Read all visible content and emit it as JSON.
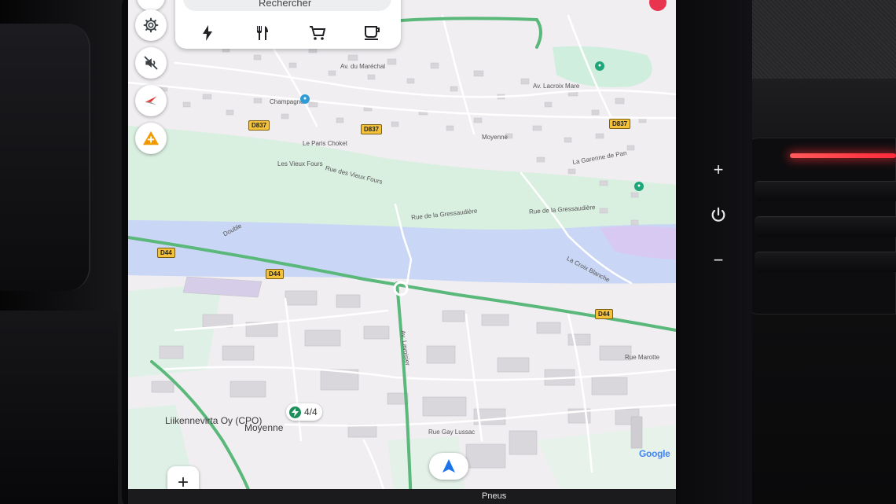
{
  "search": {
    "placeholder": "Rechercher"
  },
  "categories": [
    {
      "icon": "lightning-icon",
      "label": ""
    },
    {
      "icon": "restaurant-icon",
      "label": ""
    },
    {
      "icon": "shopping-cart-icon",
      "label": ""
    },
    {
      "icon": "coffee-icon",
      "label": ""
    }
  ],
  "side_controls": [
    {
      "icon": "gear-icon"
    },
    {
      "icon": "sound-muted-icon"
    },
    {
      "icon": "compass-icon"
    },
    {
      "icon": "traffic-alert-icon"
    }
  ],
  "zoom": {
    "in_label": "+"
  },
  "charger": {
    "name": "Liikennevirta Oy (CPO)",
    "availability": "4/4",
    "city": "Moyenne"
  },
  "road_shields": {
    "d837_a": "D837",
    "d837_b": "D837",
    "d837_c": "D837",
    "d44_a": "D44",
    "d44_b": "D44",
    "d44_c": "D44"
  },
  "map_labels": {
    "av_marechal": "Av. du Maréchal",
    "champagne": "Champagne",
    "paris_chokat": "Le Paris Choket",
    "vieux_fours": "Les Vieux Fours",
    "rue_vieux_fours": "Rue des Vieux Fours",
    "rue_gressaudiere": "Rue de la Gressaudière",
    "rue_gressaudiere_2": "Rue de la Gressaudière",
    "croix_blanche": "La Croix Blanche",
    "double": "Double",
    "av_lavoisier": "Av. Lavoisier",
    "rue_marotte": "Rue Marotte",
    "rue_gay_lussac": "Rue Gay Lussac",
    "garenne": "La Garenne de Pan",
    "moyenne": "Moyenne",
    "av_lacroix_mare": "Av. Lacroix Mare"
  },
  "bottom_bar": {
    "text": "Pneus"
  },
  "hardware": {
    "vol_up": "+",
    "vol_down": "−"
  },
  "attribution": "Google",
  "colors": {
    "water": "#c9d6f5",
    "park": "#d9efe0",
    "road_major": "#59b87a",
    "road_minor": "#ffffff",
    "building": "#d7d5d9",
    "shield": "#f3c13a",
    "accent_blue": "#1a73e8",
    "charger_green": "#1e8e5a"
  }
}
